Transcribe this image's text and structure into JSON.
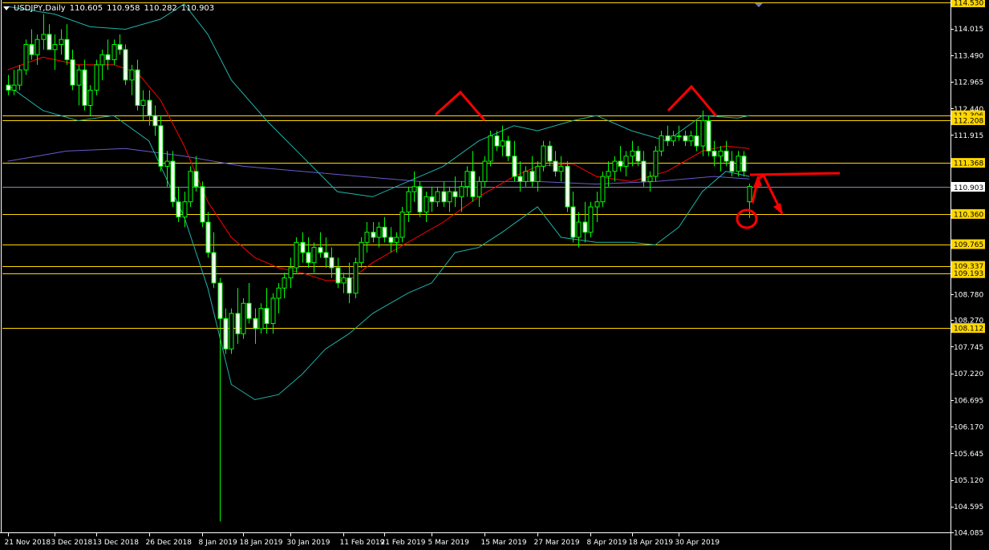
{
  "header": {
    "symbol": "USDJPY,Daily",
    "open": "110.605",
    "high": "110.958",
    "low": "110.282",
    "close": "110.903"
  },
  "colors": {
    "background": "#000000",
    "axis": "#ffffff",
    "bull_candle": "#00ff00",
    "bear_candle_body": "#ffffff",
    "bollinger": "#20b2aa",
    "ma_red": "#ff0000",
    "ma_blue": "#6a5acd",
    "level_line": "#ffd700",
    "level_label_bg": "#ffd700",
    "annotation": "#ff0000"
  },
  "chart_data": {
    "type": "candlestick",
    "symbol": "USDJPY",
    "timeframe": "Daily",
    "ylim": [
      104.085,
      114.53
    ],
    "y_ticks": [
      "114.015",
      "113.490",
      "112.965",
      "112.440",
      "111.915",
      "110.903",
      "108.780",
      "108.270",
      "107.745",
      "107.220",
      "106.695",
      "106.170",
      "105.645",
      "105.120",
      "104.595",
      "104.085"
    ],
    "x_ticks": [
      "21 Nov 2018",
      "3 Dec 2018",
      "13 Dec 2018",
      "26 Dec 2018",
      "8 Jan 2019",
      "18 Jan 2019",
      "30 Jan 2019",
      "11 Feb 2019",
      "21 Feb 2019",
      "5 Mar 2019",
      "15 Mar 2019",
      "27 Mar 2019",
      "8 Apr 2019",
      "18 Apr 2019",
      "30 Apr 2019"
    ],
    "horizontal_levels": [
      "114.530",
      "112.306",
      "112.208",
      "111.368",
      "110.360",
      "109.765",
      "109.337",
      "109.193",
      "108.112"
    ],
    "current_price": "110.903",
    "candles": [
      [
        112.9,
        113.1,
        112.7,
        112.8
      ],
      [
        112.8,
        113.2,
        112.7,
        112.9
      ],
      [
        112.9,
        113.3,
        112.8,
        113.2
      ],
      [
        113.2,
        113.8,
        113.1,
        113.7
      ],
      [
        113.7,
        114.0,
        113.4,
        113.5
      ],
      [
        113.5,
        113.9,
        113.3,
        113.8
      ],
      [
        113.8,
        114.3,
        113.6,
        113.9
      ],
      [
        113.9,
        114.1,
        113.6,
        113.6
      ],
      [
        113.6,
        113.9,
        113.2,
        113.7
      ],
      [
        113.7,
        114.0,
        113.5,
        113.8
      ],
      [
        113.8,
        114.1,
        113.3,
        113.4
      ],
      [
        113.4,
        113.6,
        112.8,
        112.9
      ],
      [
        112.9,
        113.3,
        112.5,
        113.2
      ],
      [
        113.2,
        113.4,
        112.4,
        112.5
      ],
      [
        112.5,
        112.9,
        112.3,
        112.8
      ],
      [
        112.8,
        113.4,
        112.7,
        113.3
      ],
      [
        113.3,
        113.6,
        113.0,
        113.5
      ],
      [
        113.5,
        113.8,
        113.2,
        113.4
      ],
      [
        113.4,
        113.8,
        113.3,
        113.7
      ],
      [
        113.7,
        113.9,
        113.5,
        113.6
      ],
      [
        113.6,
        113.7,
        112.9,
        113.0
      ],
      [
        113.0,
        113.3,
        112.7,
        113.2
      ],
      [
        113.2,
        113.4,
        112.4,
        112.5
      ],
      [
        112.5,
        112.8,
        112.2,
        112.6
      ],
      [
        112.6,
        112.8,
        112.1,
        112.3
      ],
      [
        112.3,
        112.5,
        111.9,
        112.1
      ],
      [
        112.1,
        112.3,
        111.2,
        111.3
      ],
      [
        111.3,
        111.6,
        110.9,
        111.4
      ],
      [
        111.4,
        111.6,
        110.5,
        110.6
      ],
      [
        110.6,
        110.9,
        110.2,
        110.3
      ],
      [
        110.3,
        110.8,
        110.1,
        110.6
      ],
      [
        110.6,
        111.3,
        110.5,
        111.2
      ],
      [
        111.2,
        111.5,
        110.8,
        110.9
      ],
      [
        110.9,
        111.0,
        110.1,
        110.2
      ],
      [
        110.2,
        110.4,
        109.5,
        109.6
      ],
      [
        109.6,
        110.0,
        108.9,
        109.0
      ],
      [
        109.0,
        109.1,
        104.3,
        108.3
      ],
      [
        108.3,
        108.5,
        107.6,
        107.7
      ],
      [
        107.7,
        108.5,
        107.6,
        108.4
      ],
      [
        108.4,
        108.9,
        107.8,
        108.0
      ],
      [
        108.0,
        108.7,
        107.9,
        108.6
      ],
      [
        108.6,
        109.0,
        108.2,
        108.3
      ],
      [
        108.3,
        108.5,
        107.8,
        108.1
      ],
      [
        108.1,
        108.6,
        108.0,
        108.5
      ],
      [
        108.5,
        108.9,
        108.0,
        108.2
      ],
      [
        108.2,
        108.8,
        108.0,
        108.7
      ],
      [
        108.7,
        109.0,
        108.4,
        108.9
      ],
      [
        108.9,
        109.2,
        108.7,
        109.1
      ],
      [
        109.1,
        109.5,
        108.9,
        109.3
      ],
      [
        109.3,
        109.9,
        109.2,
        109.8
      ],
      [
        109.8,
        110.0,
        109.4,
        109.6
      ],
      [
        109.6,
        109.9,
        109.3,
        109.4
      ],
      [
        109.4,
        109.8,
        109.2,
        109.7
      ],
      [
        109.7,
        110.0,
        109.5,
        109.6
      ],
      [
        109.6,
        109.9,
        109.3,
        109.5
      ],
      [
        109.5,
        109.7,
        109.1,
        109.3
      ],
      [
        109.3,
        109.5,
        108.9,
        109.0
      ],
      [
        109.0,
        109.2,
        108.8,
        109.1
      ],
      [
        109.1,
        109.4,
        108.6,
        108.8
      ],
      [
        108.8,
        109.5,
        108.7,
        109.4
      ],
      [
        109.4,
        109.9,
        109.3,
        109.8
      ],
      [
        109.8,
        110.2,
        109.6,
        110.0
      ],
      [
        110.0,
        110.2,
        109.8,
        109.9
      ],
      [
        109.9,
        110.2,
        109.7,
        110.1
      ],
      [
        110.1,
        110.3,
        109.8,
        109.9
      ],
      [
        109.9,
        110.1,
        109.6,
        109.8
      ],
      [
        109.8,
        110.0,
        109.6,
        109.9
      ],
      [
        109.9,
        110.5,
        109.8,
        110.4
      ],
      [
        110.4,
        110.9,
        110.2,
        110.8
      ],
      [
        110.8,
        111.2,
        110.6,
        110.9
      ],
      [
        110.9,
        111.0,
        110.3,
        110.4
      ],
      [
        110.4,
        110.8,
        110.2,
        110.7
      ],
      [
        110.7,
        110.9,
        110.4,
        110.6
      ],
      [
        110.6,
        110.9,
        110.5,
        110.8
      ],
      [
        110.8,
        111.0,
        110.5,
        110.6
      ],
      [
        110.6,
        110.9,
        110.4,
        110.8
      ],
      [
        110.8,
        111.1,
        110.5,
        110.7
      ],
      [
        110.7,
        111.0,
        110.4,
        110.9
      ],
      [
        110.9,
        111.3,
        110.7,
        111.2
      ],
      [
        111.2,
        111.6,
        110.6,
        110.7
      ],
      [
        110.7,
        111.1,
        110.5,
        111.0
      ],
      [
        111.0,
        111.5,
        110.9,
        111.4
      ],
      [
        111.4,
        112.0,
        111.3,
        111.9
      ],
      [
        111.9,
        112.0,
        111.6,
        111.7
      ],
      [
        111.7,
        112.1,
        111.5,
        111.8
      ],
      [
        111.8,
        111.9,
        111.4,
        111.5
      ],
      [
        111.5,
        111.8,
        111.0,
        111.1
      ],
      [
        111.1,
        111.4,
        110.8,
        111.0
      ],
      [
        111.0,
        111.3,
        110.9,
        111.2
      ],
      [
        111.2,
        111.5,
        110.9,
        111.0
      ],
      [
        111.0,
        111.4,
        110.8,
        111.3
      ],
      [
        111.3,
        111.8,
        111.2,
        111.7
      ],
      [
        111.7,
        111.8,
        111.3,
        111.4
      ],
      [
        111.4,
        111.6,
        111.1,
        111.2
      ],
      [
        111.2,
        111.5,
        111.0,
        111.3
      ],
      [
        111.3,
        111.4,
        110.4,
        110.5
      ],
      [
        110.5,
        110.8,
        109.8,
        109.9
      ],
      [
        109.9,
        110.4,
        109.7,
        110.2
      ],
      [
        110.2,
        110.6,
        109.8,
        110.0
      ],
      [
        110.0,
        110.6,
        109.9,
        110.5
      ],
      [
        110.5,
        110.8,
        110.2,
        110.6
      ],
      [
        110.6,
        111.2,
        110.5,
        111.1
      ],
      [
        111.1,
        111.4,
        110.9,
        111.2
      ],
      [
        111.2,
        111.5,
        111.0,
        111.4
      ],
      [
        111.4,
        111.7,
        111.2,
        111.3
      ],
      [
        111.3,
        111.6,
        111.1,
        111.5
      ],
      [
        111.5,
        111.8,
        111.3,
        111.6
      ],
      [
        111.6,
        111.7,
        111.3,
        111.4
      ],
      [
        111.4,
        111.6,
        110.9,
        111.0
      ],
      [
        111.0,
        111.2,
        110.8,
        111.1
      ],
      [
        111.1,
        111.7,
        111.0,
        111.6
      ],
      [
        111.6,
        112.0,
        111.5,
        111.9
      ],
      [
        111.9,
        112.1,
        111.7,
        111.8
      ],
      [
        111.8,
        112.0,
        111.7,
        111.9
      ],
      [
        111.9,
        112.1,
        111.8,
        111.9
      ],
      [
        111.9,
        112.0,
        111.7,
        111.8
      ],
      [
        111.8,
        112.0,
        111.7,
        111.9
      ],
      [
        111.9,
        112.2,
        111.6,
        111.7
      ],
      [
        111.7,
        112.4,
        111.5,
        112.2
      ],
      [
        112.2,
        112.3,
        111.5,
        111.6
      ],
      [
        111.6,
        111.8,
        111.3,
        111.5
      ],
      [
        111.5,
        111.7,
        111.2,
        111.6
      ],
      [
        111.6,
        111.8,
        111.3,
        111.4
      ],
      [
        111.4,
        111.6,
        111.1,
        111.2
      ],
      [
        111.2,
        111.6,
        111.1,
        111.5
      ],
      [
        111.5,
        111.6,
        111.1,
        111.2
      ],
      [
        110.6,
        110.958,
        110.282,
        110.903
      ]
    ],
    "indicators": {
      "bollinger_upper": [
        [
          0,
          114.45
        ],
        [
          8,
          114.3
        ],
        [
          14,
          114.05
        ],
        [
          20,
          114.0
        ],
        [
          26,
          114.2
        ],
        [
          30,
          114.5
        ],
        [
          34,
          113.9
        ],
        [
          38,
          113.0
        ],
        [
          44,
          112.2
        ],
        [
          50,
          111.5
        ],
        [
          56,
          110.8
        ],
        [
          62,
          110.7
        ],
        [
          68,
          111.0
        ],
        [
          74,
          111.3
        ],
        [
          80,
          111.8
        ],
        [
          86,
          112.1
        ],
        [
          90,
          112.0
        ],
        [
          96,
          112.2
        ],
        [
          100,
          112.3
        ],
        [
          106,
          112.0
        ],
        [
          112,
          111.8
        ],
        [
          118,
          112.3
        ],
        [
          124,
          112.25
        ],
        [
          126,
          112.3
        ]
      ],
      "bollinger_lower": [
        [
          0,
          112.9
        ],
        [
          6,
          112.4
        ],
        [
          12,
          112.2
        ],
        [
          18,
          112.3
        ],
        [
          24,
          111.8
        ],
        [
          30,
          110.3
        ],
        [
          34,
          108.9
        ],
        [
          38,
          107.0
        ],
        [
          42,
          106.7
        ],
        [
          46,
          106.8
        ],
        [
          50,
          107.2
        ],
        [
          54,
          107.7
        ],
        [
          58,
          108.0
        ],
        [
          62,
          108.4
        ],
        [
          68,
          108.8
        ],
        [
          72,
          109.0
        ],
        [
          76,
          109.6
        ],
        [
          80,
          109.7
        ],
        [
          84,
          110.0
        ],
        [
          90,
          110.5
        ],
        [
          94,
          109.9
        ],
        [
          100,
          109.8
        ],
        [
          106,
          109.8
        ],
        [
          110,
          109.75
        ],
        [
          114,
          110.1
        ],
        [
          118,
          110.8
        ],
        [
          122,
          111.2
        ],
        [
          126,
          111.1
        ]
      ],
      "ma_red": [
        [
          0,
          113.2
        ],
        [
          6,
          113.45
        ],
        [
          12,
          113.3
        ],
        [
          18,
          113.3
        ],
        [
          22,
          113.15
        ],
        [
          26,
          112.6
        ],
        [
          30,
          111.7
        ],
        [
          34,
          110.6
        ],
        [
          38,
          109.9
        ],
        [
          42,
          109.5
        ],
        [
          46,
          109.3
        ],
        [
          50,
          109.2
        ],
        [
          54,
          109.05
        ],
        [
          58,
          109.05
        ],
        [
          62,
          109.4
        ],
        [
          68,
          109.8
        ],
        [
          74,
          110.2
        ],
        [
          80,
          110.7
        ],
        [
          86,
          111.1
        ],
        [
          90,
          111.3
        ],
        [
          96,
          111.35
        ],
        [
          100,
          111.1
        ],
        [
          106,
          111.0
        ],
        [
          112,
          111.2
        ],
        [
          118,
          111.6
        ],
        [
          122,
          111.7
        ],
        [
          126,
          111.65
        ]
      ],
      "ma_blue": [
        [
          0,
          111.4
        ],
        [
          10,
          111.6
        ],
        [
          20,
          111.65
        ],
        [
          30,
          111.5
        ],
        [
          40,
          111.3
        ],
        [
          50,
          111.2
        ],
        [
          60,
          111.1
        ],
        [
          70,
          111.0
        ],
        [
          80,
          111.0
        ],
        [
          90,
          111.0
        ],
        [
          100,
          110.95
        ],
        [
          110,
          111.0
        ],
        [
          120,
          111.1
        ],
        [
          126,
          111.05
        ]
      ]
    },
    "annotations": [
      "double-top",
      "resistance-line",
      "support-circle",
      "projection-arrows"
    ]
  }
}
